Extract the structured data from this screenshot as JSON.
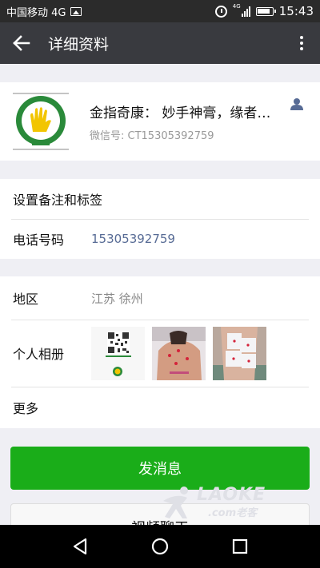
{
  "status_bar": {
    "carrier": "中国移动 4G",
    "net_badge": "4G",
    "time": "15:43",
    "icons": [
      "image-icon",
      "alarm-icon",
      "signal-icon",
      "battery-icon"
    ]
  },
  "header": {
    "title": "详细资料",
    "back_icon": "back-arrow-icon",
    "more_icon": "more-vertical-icon"
  },
  "profile": {
    "name": "金指奇康：  妙手神膏，缘者…",
    "wechat_id": "微信号: CT15305392759",
    "contact_icon": "contact-person-icon",
    "accent": "#2a8a3a"
  },
  "section1": {
    "remark_label": "设置备注和标签",
    "phone_label": "电话号码",
    "phone_value": "15305392759"
  },
  "section2": {
    "region_label": "地区",
    "region_value": "江苏  徐州",
    "album_label": "个人相册",
    "album_thumbs": [
      "qr-code-thumb",
      "back-photo-thumb",
      "arm-photo-thumb"
    ],
    "more_label": "更多"
  },
  "actions": {
    "send_message": "发消息",
    "video_call": "视频聊天"
  },
  "watermark": {
    "brand": "LAOKE",
    "domain": ".com老客"
  },
  "colors": {
    "title_bar": "#393a3f",
    "status_bar": "#2b2b2b",
    "primary_button": "#1aad19",
    "link": "#576b95"
  }
}
